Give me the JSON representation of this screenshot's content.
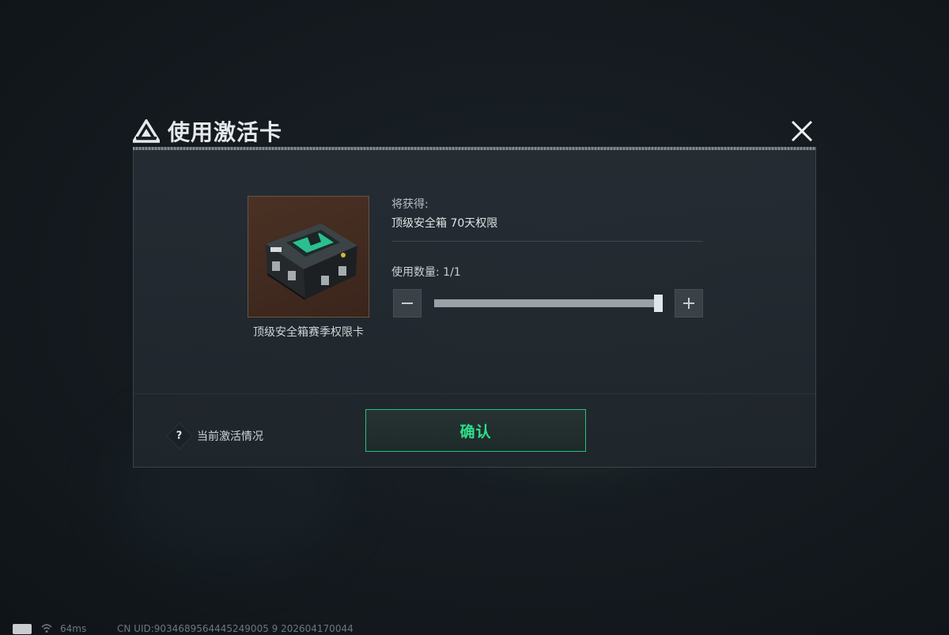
{
  "dialog": {
    "title": "使用激活卡",
    "item_name": "顶级安全箱赛季权限卡",
    "reward_label": "将获得:",
    "reward_value": "顶级安全箱 70天权限",
    "quantity_label": "使用数量:  1/1",
    "quantity_current": 1,
    "quantity_max": 1,
    "minus_glyph": "−",
    "plus_glyph": "+",
    "help_glyph": "?",
    "help_text": "当前激活情况",
    "confirm_label": "确认"
  },
  "status_bar": {
    "ping": "64ms",
    "uid": "CN UID:9034689564445249005 9 202604170044"
  },
  "colors": {
    "accent_green": "#2ee08c",
    "confirm_border": "#27c07a",
    "item_bg": "#4a3124"
  },
  "icons": [
    "logo-icon",
    "close-icon",
    "minus-icon",
    "plus-icon",
    "help-icon",
    "battery-icon",
    "wifi-icon"
  ]
}
